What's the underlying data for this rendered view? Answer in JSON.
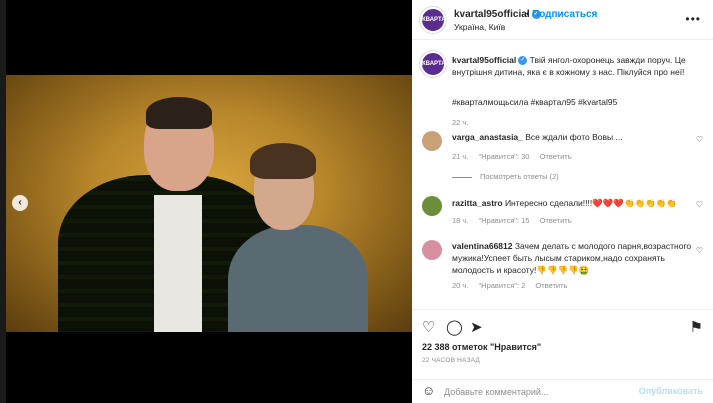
{
  "post": {
    "username": "kvartal95official",
    "follow_label": "Подписаться",
    "separator": "•",
    "location": "Україна, Київ",
    "avatar_text": "КВАРТАЛ 95",
    "caption": "Твій янгол-охоронець завжди поруч. Це внутрішня дитина, яка є в кожному з нас. Піклуйся про неї!",
    "hashtags": "#кварталмощьсила #квартал95 #kvartal95",
    "caption_time": "22 ч."
  },
  "comments": [
    {
      "username": "varga_anastasia_",
      "text": "Все ждали фото Вовы ...",
      "time": "21 ч.",
      "likes": "\"Нравится\": 30",
      "reply": "Ответить",
      "view_replies": "Посмотреть ответы (2)",
      "avatar_color": "#c9a27a"
    },
    {
      "username": "razitta_astro",
      "text": "Интересно сделали!!!!❤️❤️❤️👏👏👏👏👏",
      "time": "18 ч.",
      "likes": "\"Нравится\": 15",
      "reply": "Ответить",
      "avatar_color": "#6b8e3a"
    },
    {
      "username": "valentina66812",
      "text": "Зачем делать с молодого парня,возрастного мужика!Успеет быть лысым стариком,надо сохранять молодость и красоту!👎👎👎👎🤮",
      "time": "20 ч.",
      "likes": "\"Нравится\": 2",
      "reply": "Ответить",
      "avatar_color": "#d88fa0"
    }
  ],
  "actions": {
    "likes": "22 388 отметок \"Нравится\"",
    "time": "22 ЧАСОВ НАЗАД"
  },
  "add_comment": {
    "placeholder": "Добавьте комментарий...",
    "publish": "Опубликовать"
  },
  "carousel": {
    "total": 8,
    "current": 7
  },
  "icons": {
    "more": "more-icon",
    "heart": "heart-icon",
    "comment": "comment-icon",
    "share": "share-icon",
    "save": "bookmark-icon",
    "emoji": "emoji-icon"
  },
  "colors": {
    "link": "#0095f6",
    "hashtag": "#00376b",
    "muted": "#8e8e8e",
    "verified": "#3897f0"
  }
}
